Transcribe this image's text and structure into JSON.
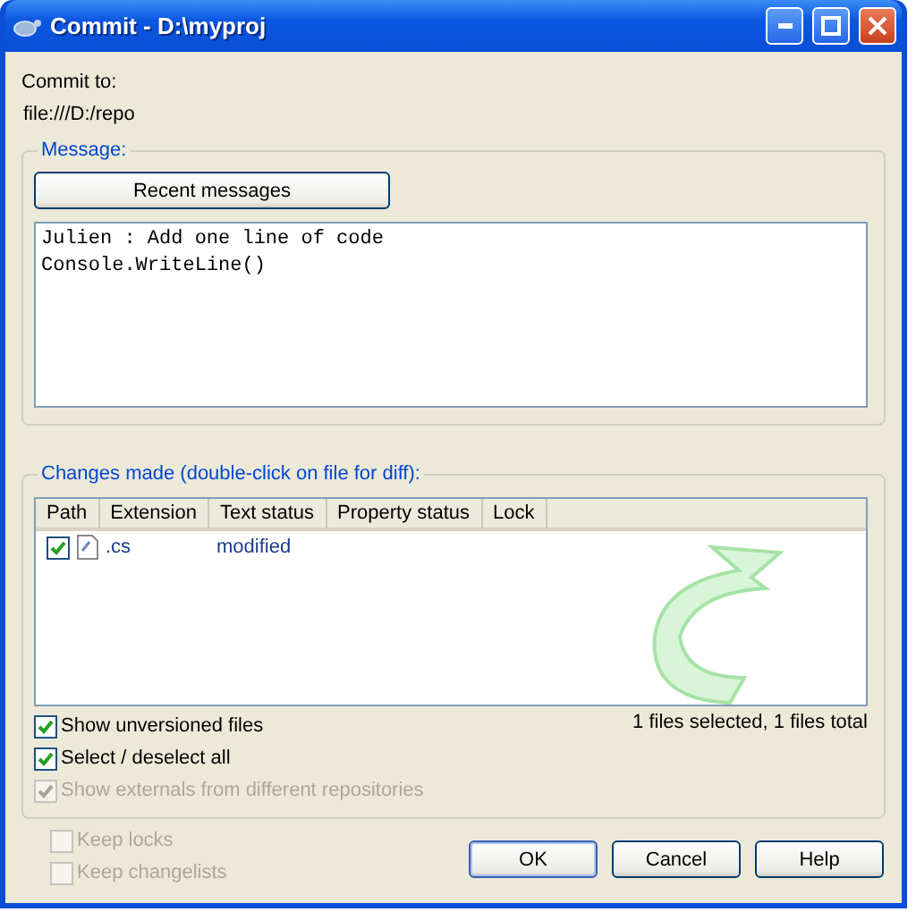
{
  "window": {
    "title": "Commit - D:\\myproj"
  },
  "commit_to": {
    "label": "Commit to:",
    "url": "file:///D:/repo"
  },
  "message": {
    "group_label": "Message:",
    "recent_button": "Recent messages",
    "lines": [
      "Julien : Add one line of code",
      "Console.WriteLine()"
    ]
  },
  "changes": {
    "group_label": "Changes made (double-click on file for diff):",
    "columns": [
      "Path",
      "Extension",
      "Text status",
      "Property status",
      "Lock"
    ],
    "rows": [
      {
        "checked": true,
        "path": "",
        "extension": ".cs",
        "text_status": "modified"
      }
    ],
    "summary": "1 files selected, 1 files total",
    "options": [
      {
        "label": "Show unversioned files",
        "checked": true,
        "disabled": false
      },
      {
        "label": "Select / deselect all",
        "checked": true,
        "disabled": false
      },
      {
        "label": "Show externals from different repositories",
        "checked": true,
        "disabled": true
      }
    ]
  },
  "bottom_options": [
    {
      "label": "Keep locks",
      "checked": false,
      "disabled": true
    },
    {
      "label": "Keep changelists",
      "checked": false,
      "disabled": true
    }
  ],
  "buttons": [
    {
      "label": "OK",
      "default": true
    },
    {
      "label": "Cancel",
      "default": false
    },
    {
      "label": "Help",
      "default": false
    }
  ]
}
